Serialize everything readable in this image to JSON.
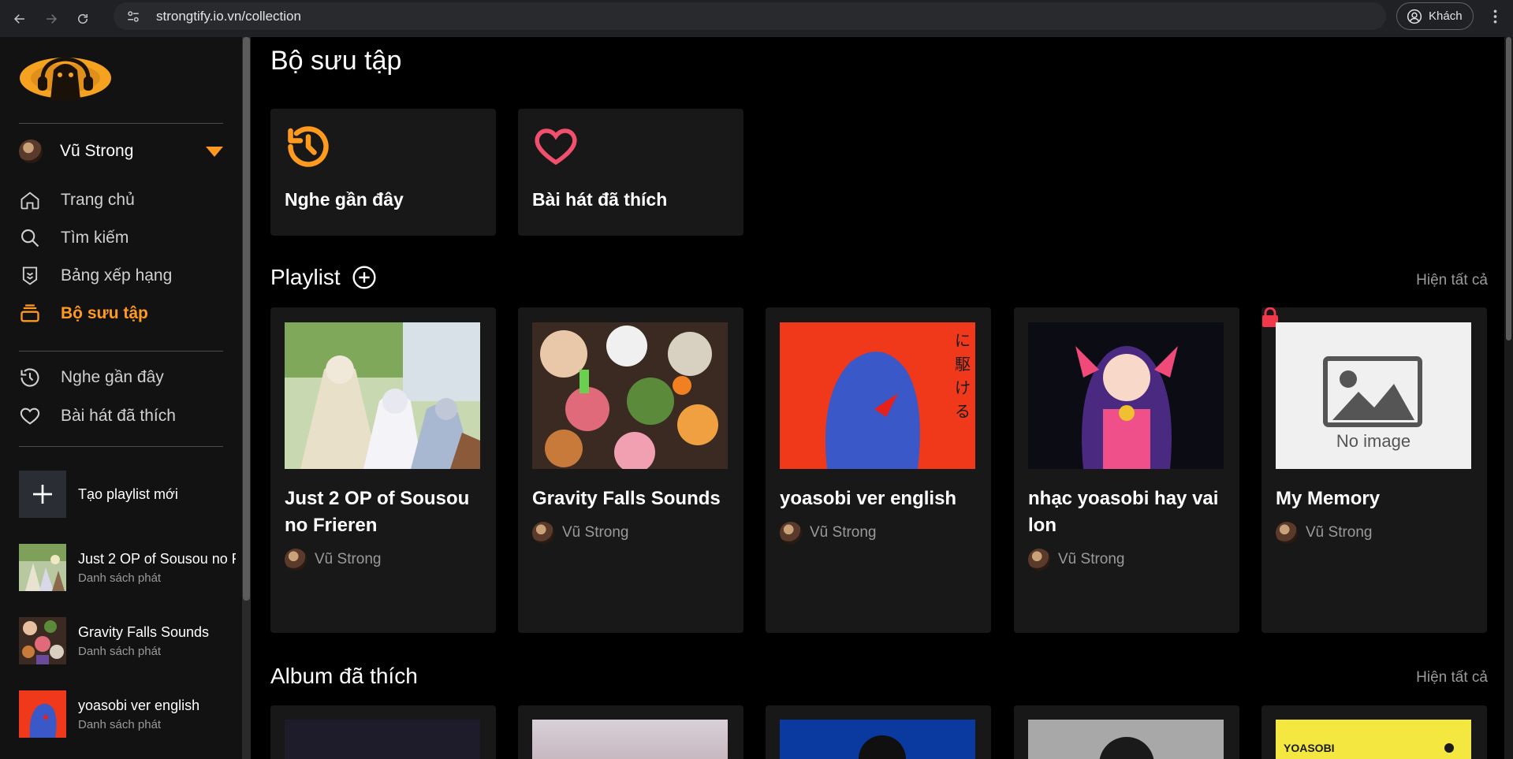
{
  "browser": {
    "url": "strongtify.io.vn/collection",
    "guest_label": "Khách"
  },
  "sidebar": {
    "user_name": "Vũ Strong",
    "menu": [
      {
        "label": "Trang chủ",
        "icon": "home-icon"
      },
      {
        "label": "Tìm kiếm",
        "icon": "search-icon"
      },
      {
        "label": "Bảng xếp hạng",
        "icon": "ranking-icon"
      },
      {
        "label": "Bộ sưu tập",
        "icon": "collection-icon",
        "active": true
      }
    ],
    "secondary": [
      {
        "label": "Nghe gần đây",
        "icon": "history-icon"
      },
      {
        "label": "Bài hát đã thích",
        "icon": "heart-icon"
      }
    ],
    "create_label": "Tạo playlist mới",
    "playlists": [
      {
        "title": "Just 2 OP of Sousou no Frieren",
        "sub": "Danh sách phát"
      },
      {
        "title": "Gravity Falls Sounds",
        "sub": "Danh sách phát"
      },
      {
        "title": "yoasobi ver english",
        "sub": "Danh sách phát"
      }
    ]
  },
  "main": {
    "page_title": "Bộ sưu tập",
    "quick": [
      {
        "label": "Nghe gần đây",
        "icon": "history-icon"
      },
      {
        "label": "Bài hát đã thích",
        "icon": "heart-icon"
      }
    ],
    "playlist_section": {
      "title": "Playlist",
      "show_all": "Hiện tất cả",
      "items": [
        {
          "title": "Just 2 OP of Sousou no Frieren",
          "owner": "Vũ Strong"
        },
        {
          "title": "Gravity Falls Sounds",
          "owner": "Vũ Strong"
        },
        {
          "title": "yoasobi ver english",
          "owner": "Vũ Strong"
        },
        {
          "title": "nhạc yoasobi hay vai lon",
          "owner": "Vũ Strong"
        },
        {
          "title": "My Memory",
          "owner": "Vũ Strong",
          "private": true,
          "no_image_label": "No image"
        }
      ]
    },
    "album_section": {
      "title": "Album đã thích",
      "show_all": "Hiện tất cả",
      "yoasobi_label": "YOASOBI"
    }
  },
  "colors": {
    "accent": "#ff9a1f",
    "heart": "#f0506e",
    "background": "#000000",
    "card": "#181818",
    "sidebar": "#121212"
  }
}
